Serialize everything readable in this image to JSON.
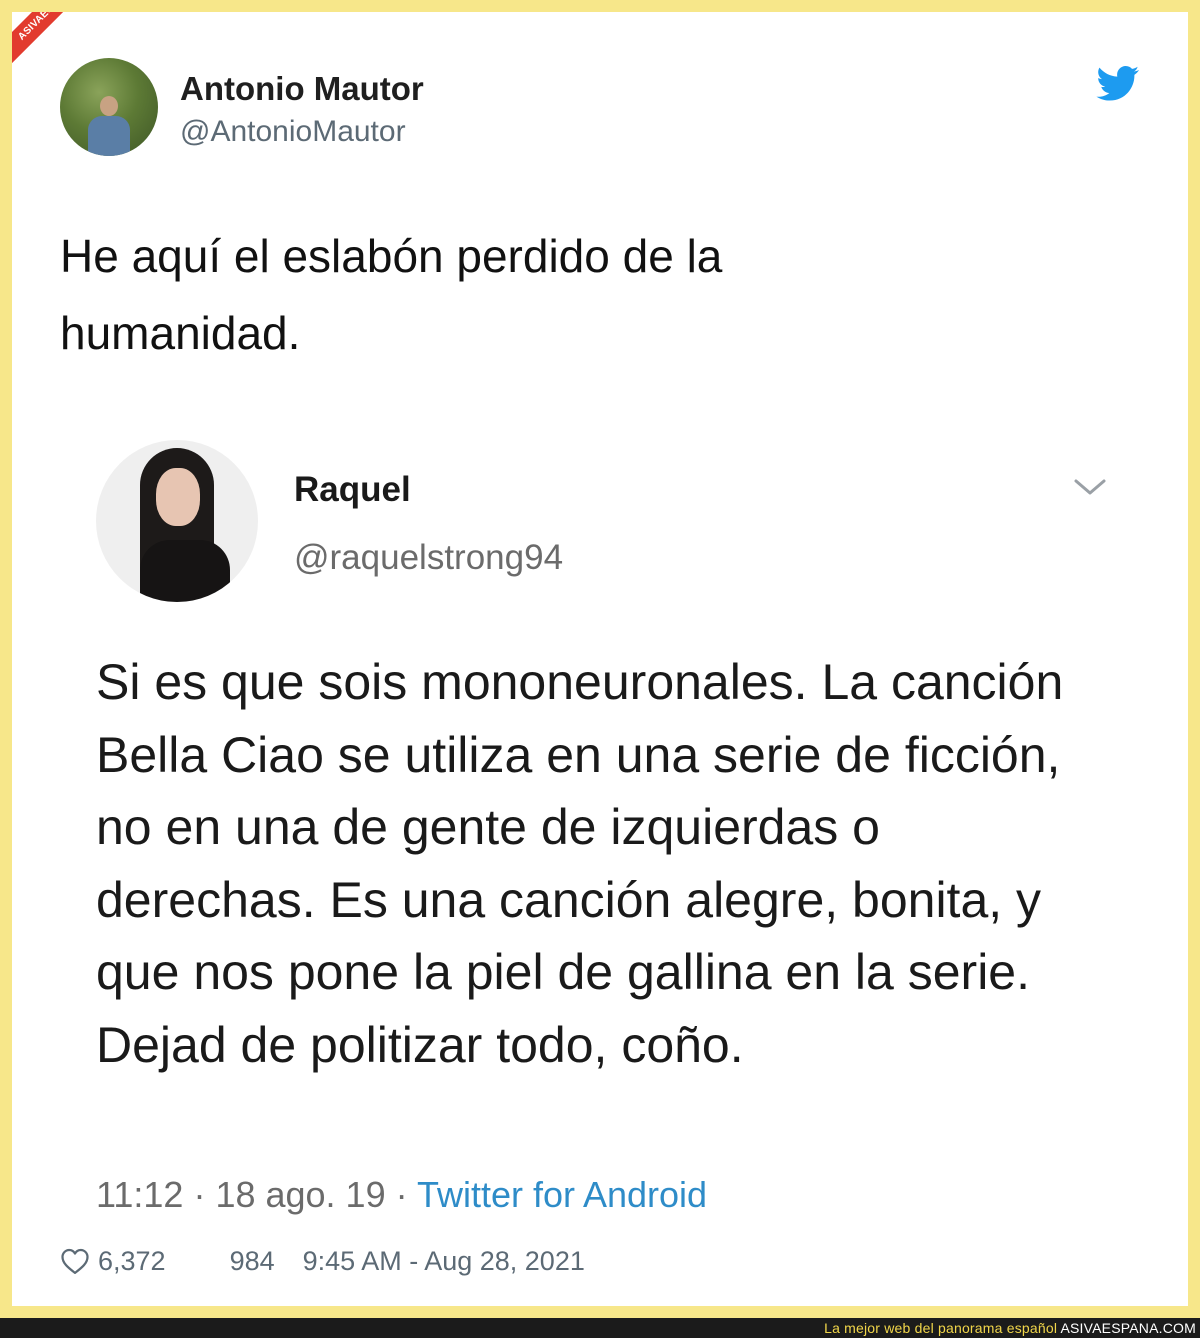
{
  "watermark": {
    "ribbon_text": "ASIVAESPANA.COM"
  },
  "tweet": {
    "author_name": "Antonio Mautor",
    "author_handle": "@AntonioMautor",
    "text": "He aquí el eslabón perdido de la humanidad.",
    "likes": "6,372",
    "retweets": "984",
    "timestamp": "9:45 AM - Aug 28, 2021"
  },
  "quoted": {
    "author_name": "Raquel",
    "author_handle": "@raquelstrong94",
    "text": "Si es que sois mononeuronales. La canción Bella Ciao se utiliza en una serie de ficción, no en una de gente de izquierdas o derechas. Es una canción alegre, bonita, y que nos pone la piel de gallina en la serie. Dejad de politizar todo, coño.",
    "time": "11:12",
    "date": "18 ago. 19",
    "source": "Twitter for Android"
  },
  "footer": {
    "tagline": "La mejor web del panorama español",
    "site": "ASIVAESPANA.COM"
  },
  "colors": {
    "frame": "#f7e78a",
    "twitter_blue": "#1d9bf0",
    "link_blue": "#2e8cc8",
    "ribbon_red": "#e23b2e"
  },
  "icons": [
    "twitter-bird-icon",
    "chevron-down-icon",
    "heart-icon"
  ]
}
